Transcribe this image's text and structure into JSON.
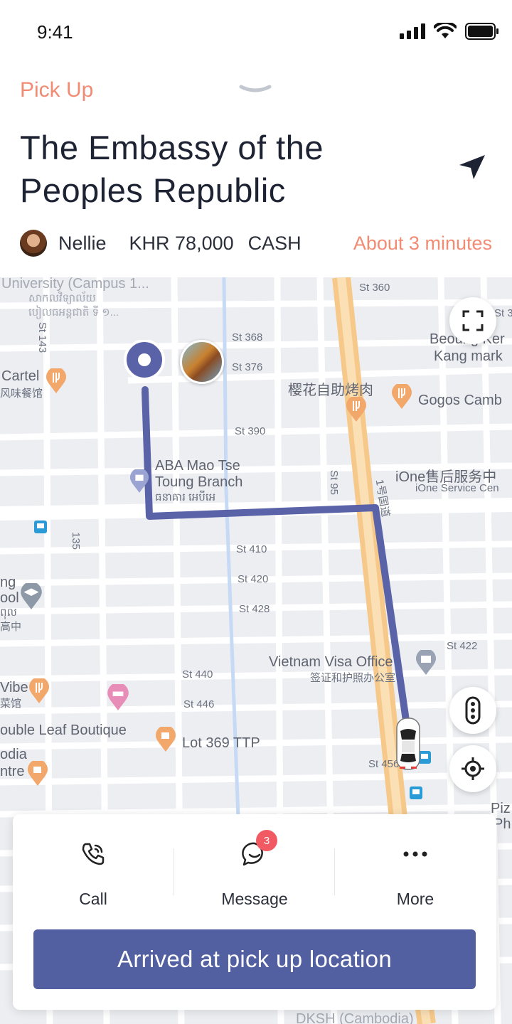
{
  "status_bar": {
    "time": "9:41"
  },
  "header": {
    "pickup_label": "Pick Up",
    "place_title_line1": "The Embassy of the",
    "place_title_line2": "Peoples Republic",
    "rider_name": "Nellie",
    "fare": "KHR 78,000",
    "payment_method": "CASH",
    "eta": "About 3 minutes"
  },
  "map": {
    "labels": {
      "university": "University (Campus 1...",
      "khmer_top_1": "សាកលវិទ្យាល័យ",
      "khmer_top_2": "បៀលធអន្តជាតិ ទី ១...",
      "st_360": "St 360",
      "st_3": "St 3",
      "st_143": "St 143",
      "st_368": "St 368",
      "st_376": "St 376",
      "beoung_1": "Beoung Ker",
      "beoung_2": "Kang mark",
      "cartel": "Cartel",
      "cartel_zh": "风味餐馆",
      "bbq_zh": "樱花自助烤肉",
      "gogos": "Gogos Camb",
      "st_390": "St 390",
      "aba_1": "ABA Mao Tse",
      "aba_2": "Toung Branch",
      "aba_3": "ធនាគារ អេបីអេ",
      "ione_zh": "iOne售后服务中",
      "ione_en": "iOne Service Cen",
      "st_95": "St 95",
      "road_zh": "1号国道",
      "st_135": "135",
      "st_410": "St 410",
      "st_420": "St 420",
      "st_428": "St 428",
      "school_1": "ng",
      "school_2": "ool",
      "school_3": "ពុល",
      "school_4": "高中",
      "vietnam_1": "Vietnam Visa Office",
      "vietnam_2": "签证和护照办公室",
      "st_422": "St 422",
      "st_440": "St 440",
      "st_446": "St 446",
      "vibe": "Vibe",
      "vibe_zh": "菜馆",
      "double_leaf": "ouble Leaf Boutique",
      "lot369": "Lot 369 TTP",
      "st_456": "St 456",
      "odia": "odia",
      "ntre": "ntre",
      "piz": "Piz",
      "ph": "Ph",
      "dksh": "DKSH (Cambodia)"
    }
  },
  "actions": {
    "call_label": "Call",
    "message_label": "Message",
    "message_badge": "3",
    "more_label": "More"
  },
  "primary_button": {
    "label": "Arrived at pick up location"
  },
  "colors": {
    "accent": "#f28b73",
    "route": "#5a62a8",
    "primary_button": "#525fa0",
    "badge": "#f25a63",
    "highway": "#f6c98a"
  }
}
